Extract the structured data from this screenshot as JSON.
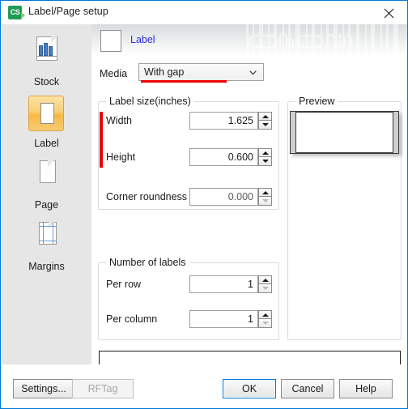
{
  "window": {
    "title": "Label/Page setup",
    "icon": "CS",
    "icon_name": "app-icon",
    "close_icon": "close-icon"
  },
  "sidebar": {
    "items": [
      {
        "label": "Stock",
        "icon": "stock-icon",
        "selected": false
      },
      {
        "label": "Label",
        "icon": "label-icon",
        "selected": true
      },
      {
        "label": "Page",
        "icon": "page-icon",
        "selected": false
      },
      {
        "label": "Margins",
        "icon": "margins-icon",
        "selected": false
      }
    ]
  },
  "header": {
    "title": "Label",
    "title_color": "#2b2bdc"
  },
  "form": {
    "media_label": "Media",
    "media_value": "With gap",
    "media_options": [
      "With gap"
    ],
    "highlight_color": "#ee0000",
    "label_size": {
      "group_title": "Label size(inches)",
      "fields": [
        {
          "label": "Width",
          "value": "1.625",
          "dim": false,
          "spin_down_disabled": false
        },
        {
          "label": "Height",
          "value": "0.600",
          "dim": false,
          "spin_down_disabled": false
        },
        {
          "label": "Corner roundness",
          "value": "0.000",
          "dim": true,
          "spin_down_disabled": true
        }
      ]
    },
    "number_of_labels": {
      "group_title": "Number of labels",
      "fields": [
        {
          "label": "Per row",
          "value": "1",
          "dim": false,
          "spin_down_disabled": true
        },
        {
          "label": "Per column",
          "value": "1",
          "dim": false,
          "spin_down_disabled": true
        }
      ]
    },
    "preview": {
      "group_title": "Preview"
    },
    "status_text": ""
  },
  "footer": {
    "settings_label": "Settings...",
    "rftag_label": "RFTag",
    "ok_label": "OK",
    "cancel_label": "Cancel",
    "help_label": "Help"
  }
}
